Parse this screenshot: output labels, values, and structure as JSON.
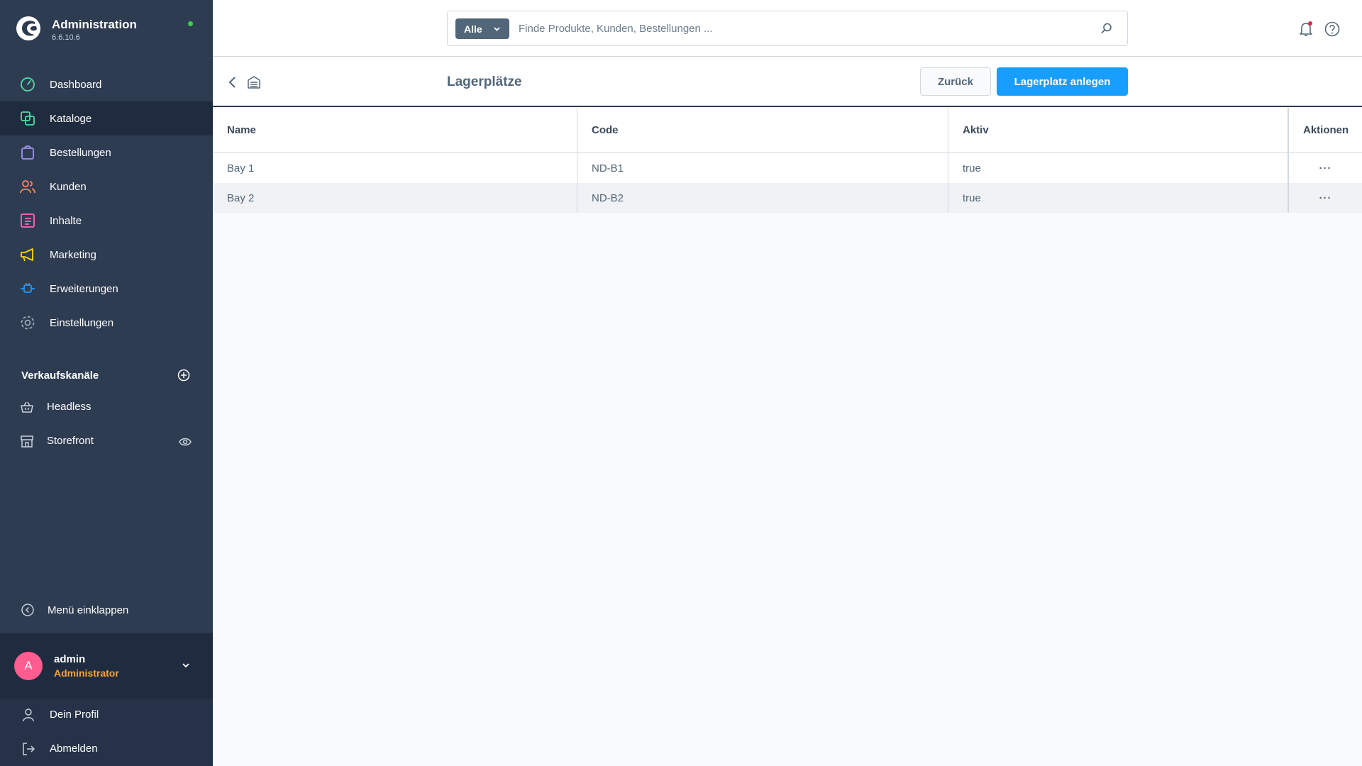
{
  "app": {
    "title": "Administration",
    "version": "6.6.10.6"
  },
  "sidebar": {
    "items": [
      {
        "label": "Dashboard",
        "icon": "dashboard-icon",
        "color": "#57d9a3"
      },
      {
        "label": "Kataloge",
        "icon": "catalog-icon",
        "color": "#57d9a3",
        "active": true
      },
      {
        "label": "Bestellungen",
        "icon": "orders-icon",
        "color": "#a092f0"
      },
      {
        "label": "Kunden",
        "icon": "customers-icon",
        "color": "#f88962"
      },
      {
        "label": "Inhalte",
        "icon": "content-icon",
        "color": "#ff68b4"
      },
      {
        "label": "Marketing",
        "icon": "marketing-icon",
        "color": "#ffd700"
      },
      {
        "label": "Erweiterungen",
        "icon": "extensions-icon",
        "color": "#189eff"
      },
      {
        "label": "Einstellungen",
        "icon": "settings-icon",
        "color": "#9aa8b5"
      }
    ],
    "sales_channels_title": "Verkaufskanäle",
    "sales_channels": [
      {
        "label": "Headless",
        "icon": "basket-icon"
      },
      {
        "label": "Storefront",
        "icon": "storefront-icon"
      }
    ],
    "collapse_label": "Menü einklappen",
    "user": {
      "initial": "A",
      "name": "admin",
      "role": "Administrator"
    },
    "profile_label": "Dein Profil",
    "logout_label": "Abmelden"
  },
  "search": {
    "type_label": "Alle",
    "placeholder": "Finde Produkte, Kunden, Bestellungen ..."
  },
  "smartbar": {
    "title": "Lagerplätze",
    "back_button": "Zurück",
    "create_button": "Lagerplatz anlegen"
  },
  "table": {
    "columns": [
      "Name",
      "Code",
      "Aktiv",
      "Aktionen"
    ],
    "rows": [
      {
        "name": "Bay 1",
        "code": "ND-B1",
        "active": "true"
      },
      {
        "name": "Bay 2",
        "code": "ND-B2",
        "active": "true"
      }
    ],
    "actions_glyph": "···"
  },
  "colors": {
    "sidebar_bg": "#2e3c52",
    "active_bg": "#1f2b3e",
    "primary": "#189eff",
    "status_online": "#37d046",
    "avatar_bg": "#ff5c8f",
    "role_color": "#f7a13c",
    "notification_dot": "#de294c"
  }
}
